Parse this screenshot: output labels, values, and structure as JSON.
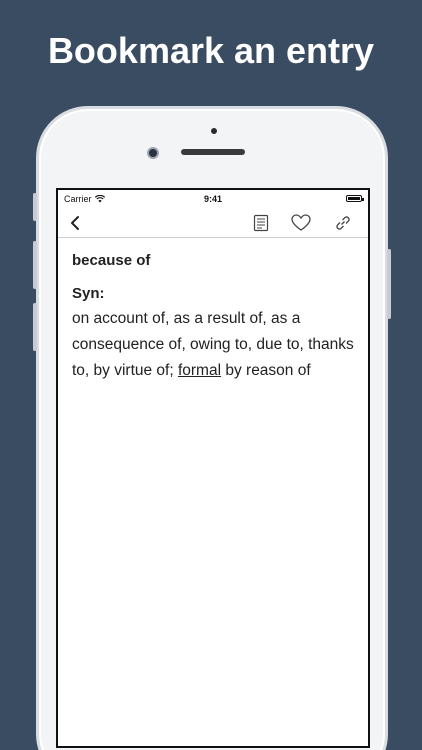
{
  "headline": "Bookmark an entry",
  "status_bar": {
    "carrier": "Carrier",
    "time": "9:41"
  },
  "nav": {
    "icons": [
      "chevron-left-icon",
      "notes-icon",
      "heart-icon",
      "link-icon"
    ]
  },
  "entry": {
    "term": "because of",
    "syn_label": "Syn:",
    "syn_before": "on account of, as a result of, as a consequence of, owing to, due to, thanks to, by virtue of; ",
    "syn_label_inline": "formal",
    "syn_after": " by reason of"
  },
  "colors": {
    "background": "#3a4c62",
    "text": "#222222",
    "screen": "#ffffff"
  }
}
